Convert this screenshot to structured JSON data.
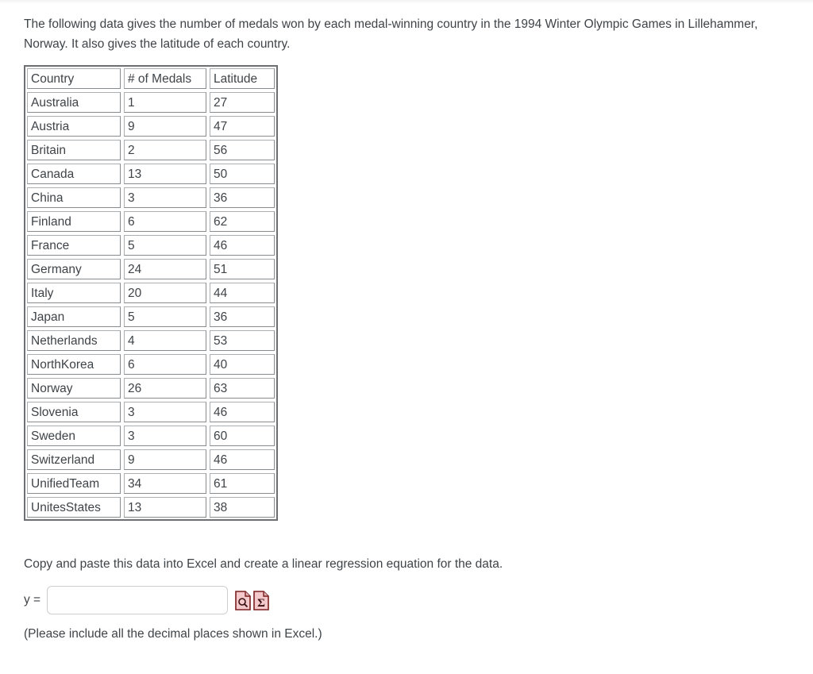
{
  "prompt": {
    "paragraph": "The following data gives the number of medals won by each medal-winning country in the 1994 Winter Olympic Games in Lillehammer, Norway. It also gives the latitude of each country."
  },
  "table": {
    "headers": [
      "Country",
      "# of Medals",
      "Latitude"
    ],
    "rows": [
      [
        "Australia",
        "1",
        "27"
      ],
      [
        "Austria",
        "9",
        "47"
      ],
      [
        "Britain",
        "2",
        "56"
      ],
      [
        "Canada",
        "13",
        "50"
      ],
      [
        "China",
        "3",
        "36"
      ],
      [
        "Finland",
        "6",
        "62"
      ],
      [
        "France",
        "5",
        "46"
      ],
      [
        "Germany",
        "24",
        "51"
      ],
      [
        "Italy",
        "20",
        "44"
      ],
      [
        "Japan",
        "5",
        "36"
      ],
      [
        "Netherlands",
        "4",
        "53"
      ],
      [
        "NorthKorea",
        "6",
        "40"
      ],
      [
        "Norway",
        "26",
        "63"
      ],
      [
        "Slovenia",
        "3",
        "46"
      ],
      [
        "Sweden",
        "3",
        "60"
      ],
      [
        "Switzerland",
        "9",
        "46"
      ],
      [
        "UnifiedTeam",
        "34",
        "61"
      ],
      [
        "UnitesStates",
        "13",
        "38"
      ]
    ]
  },
  "question": {
    "instruction": "Copy and paste this data into Excel and create a linear regression equation for the data.",
    "answer_label": "y =",
    "answer_value": "",
    "answer_placeholder": "",
    "footnote": "(Please include all the decimal places shown in Excel.)"
  },
  "tools": {
    "preview_icon": "document-magnifier-icon",
    "math_icon": "document-sigma-icon"
  },
  "colors": {
    "text": "#3f4448",
    "table_outer_border": "#6d6f72",
    "cell_border": "#888b8e",
    "icon_fill": "#f3c9cb",
    "icon_stroke": "#7a1f1f",
    "input_border": "#ccced0",
    "page_background": "#ffffff"
  }
}
